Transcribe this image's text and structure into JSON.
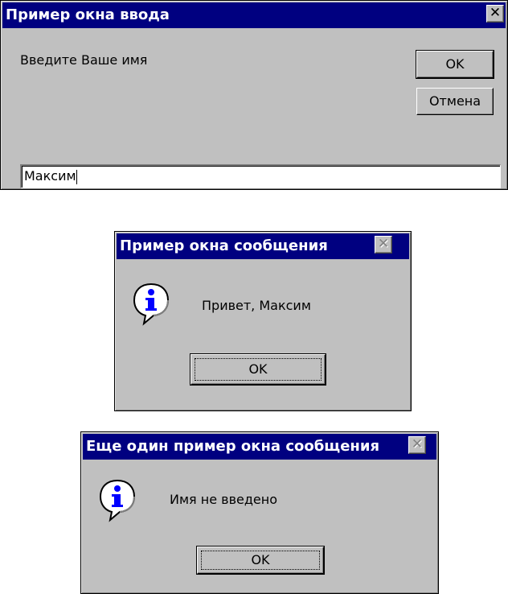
{
  "input_dialog": {
    "title": "Пример окна ввода",
    "close_glyph": "✕",
    "prompt": "Введите Ваше имя",
    "ok_label": "OK",
    "cancel_label": "Отмена",
    "input_value": "Максим"
  },
  "message_dialog_1": {
    "title": "Пример окна сообщения",
    "close_glyph": "✕",
    "icon": "info-icon",
    "message": "Привет, Максим",
    "ok_label": "OK"
  },
  "message_dialog_2": {
    "title": "Еще один пример окна сообщения",
    "close_glyph": "✕",
    "icon": "info-icon",
    "message": "Имя не введено",
    "ok_label": "OK"
  },
  "colors": {
    "titlebar": "#000080",
    "window_face": "#c0c0c0",
    "info_blue": "#0000ff"
  }
}
